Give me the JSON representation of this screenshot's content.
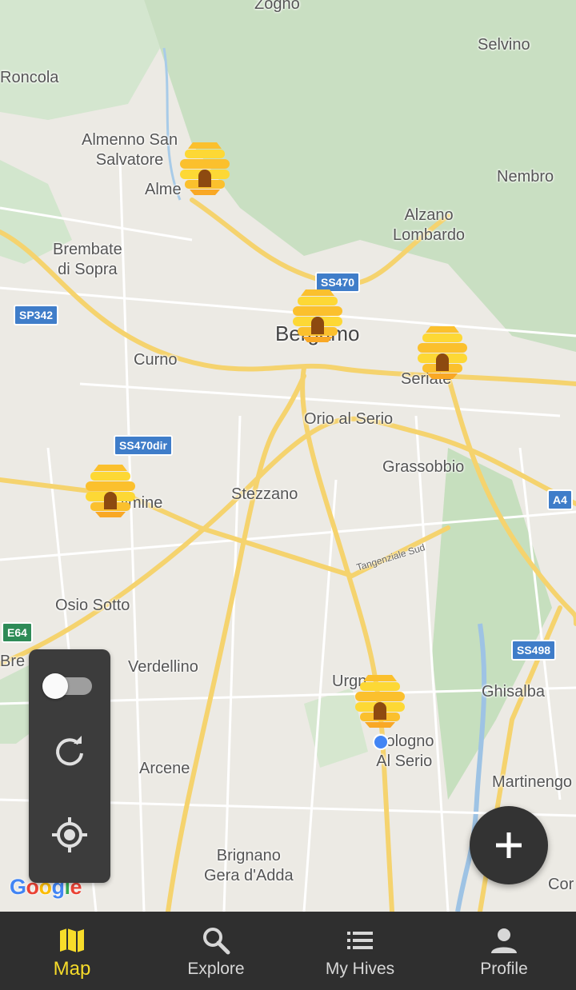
{
  "map": {
    "places": [
      {
        "name": "Zogno"
      },
      {
        "name": "Selvino"
      },
      {
        "name": "Roncola"
      },
      {
        "name": "Almenno San\nSalvatore"
      },
      {
        "name": "Alme"
      },
      {
        "name": "Nembro"
      },
      {
        "name": "Alzano\nLombardo"
      },
      {
        "name": "Brembate\ndi Sopra"
      },
      {
        "name": "Bergamo"
      },
      {
        "name": "Curno"
      },
      {
        "name": "Seriate"
      },
      {
        "name": "Orio al Serio"
      },
      {
        "name": "Grassobbio"
      },
      {
        "name": "Dalmine"
      },
      {
        "name": "Stezzano"
      },
      {
        "name": "Osio Sotto"
      },
      {
        "name": "Bre"
      },
      {
        "name": "Verdellino"
      },
      {
        "name": "Urgn"
      },
      {
        "name": "Ghisalba"
      },
      {
        "name": "Cologno\nAl Serio"
      },
      {
        "name": "Arcene"
      },
      {
        "name": "Martinengo"
      },
      {
        "name": "Brignano\nGera d'Adda"
      },
      {
        "name": "Cor"
      }
    ],
    "road_shields": [
      "SS470",
      "SP342",
      "SS470dir",
      "A4",
      "E64",
      "SS498"
    ],
    "road_label": "Tangenziale Sud",
    "attribution": "Google"
  },
  "controls": {
    "toggle_on": false,
    "refresh_icon": "refresh-icon",
    "locate_icon": "my-location-icon"
  },
  "fab": {
    "icon": "plus-icon"
  },
  "nav": {
    "items": [
      {
        "label": "Map",
        "icon": "map-icon",
        "active": true
      },
      {
        "label": "Explore",
        "icon": "search-icon",
        "active": false
      },
      {
        "label": "My Hives",
        "icon": "list-icon",
        "active": false
      },
      {
        "label": "Profile",
        "icon": "person-icon",
        "active": false
      }
    ]
  },
  "colors": {
    "accent": "#f7dc2a",
    "nav_bg": "#2f2f2f",
    "hive": "#fbc02d",
    "control_bg": "#3c3c3c"
  }
}
